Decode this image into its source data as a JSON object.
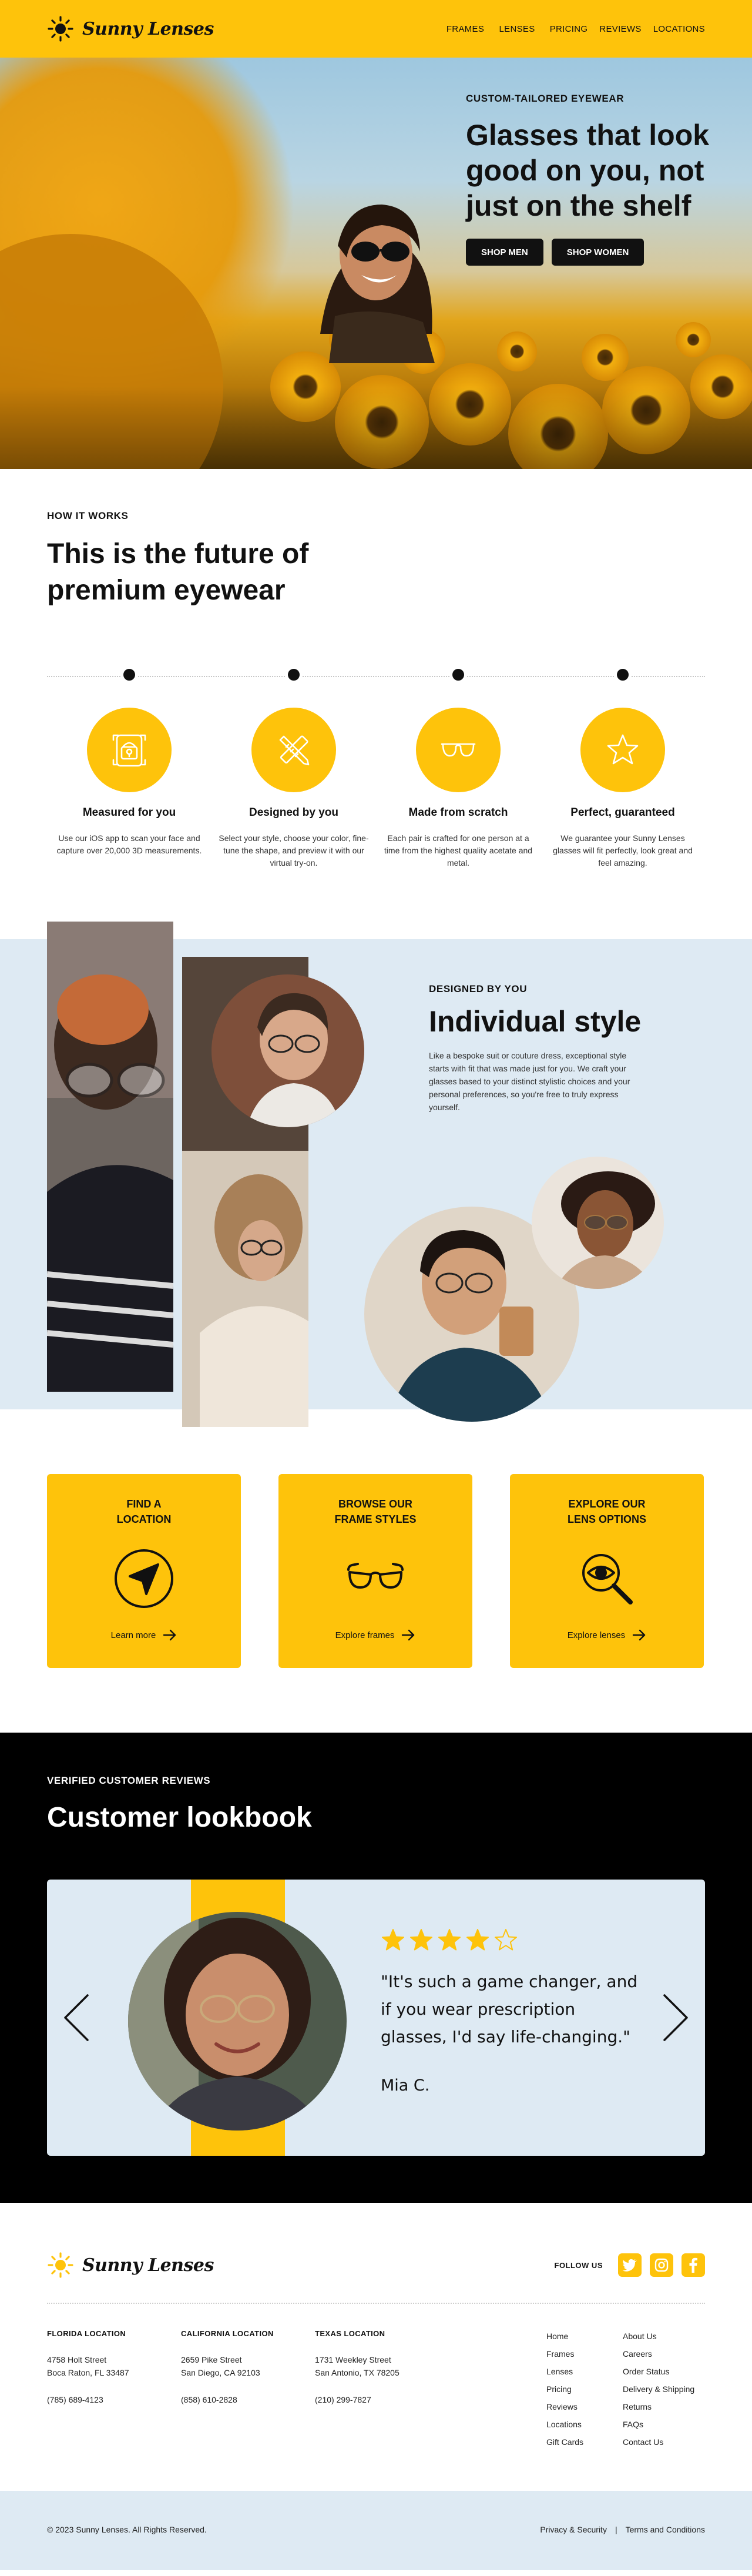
{
  "header": {
    "logo_text": "Sunny Lenses",
    "nav": [
      "FRAMES",
      "LENSES",
      "PRICING",
      "REVIEWS",
      "LOCATIONS"
    ]
  },
  "hero": {
    "eyebrow": "CUSTOM-TAILORED EYEWEAR",
    "title": "Glasses that look good on you, not just on the shelf",
    "buttons": [
      "SHOP MEN",
      "SHOP WOMEN"
    ]
  },
  "how_it_works": {
    "eyebrow": "HOW IT WORKS",
    "title": "This is the future of premium eyewear",
    "steps": [
      {
        "title": "Measured for you",
        "icon": "phone-scan-icon",
        "desc": "Use our iOS app to scan your face and capture over 20,000 3D measurements."
      },
      {
        "title": "Designed by you",
        "icon": "pencil-ruler-icon",
        "desc": "Select your style, choose your color, fine-tune the shape, and preview it with our virtual try-on."
      },
      {
        "title": "Made from scratch",
        "icon": "glasses-icon",
        "desc": "Each pair is crafted for one person at a time from the highest quality acetate and metal."
      },
      {
        "title": "Perfect, guaranteed",
        "icon": "star-icon",
        "desc": "We guarantee your Sunny Lenses glasses will fit perfectly, look great and feel amazing."
      }
    ]
  },
  "individual_style": {
    "eyebrow": "DESIGNED BY YOU",
    "title": "Individual style",
    "desc": "Like a bespoke suit or couture dress, exceptional style starts with fit that was made just for you. We craft your glasses based to your distinct stylistic choices and your personal preferences, so you're free to truly express yourself."
  },
  "cards": [
    {
      "title": "FIND A\nLOCATION",
      "icon": "navigation-arrow-icon",
      "link": "Learn more"
    },
    {
      "title": "BROWSE OUR\nFRAME STYLES",
      "icon": "glasses-icon",
      "link": "Explore frames"
    },
    {
      "title": "EXPLORE OUR\nLENS OPTIONS",
      "icon": "magnifier-eye-icon",
      "link": "Explore lenses"
    }
  ],
  "reviews": {
    "eyebrow": "VERIFIED CUSTOMER REVIEWS",
    "title": "Customer lookbook",
    "rating": 4,
    "max_rating": 5,
    "quote": "\"It's such a game changer, and if you wear prescription glasses, I'd say life-changing.\"",
    "reviewer": "Mia C."
  },
  "footer": {
    "logo_text": "Sunny Lenses",
    "follow_label": "FOLLOW US",
    "social": [
      "twitter-icon",
      "instagram-icon",
      "facebook-icon"
    ],
    "locations": [
      {
        "title": "FLORIDA LOCATION",
        "line1": "4758 Holt Street",
        "line2": "Boca Raton, FL 33487",
        "phone": "(785) 689-4123"
      },
      {
        "title": "CALIFORNIA LOCATION",
        "line1": "2659 Pike Street",
        "line2": "San Diego, CA 92103",
        "phone": "(858) 610-2828"
      },
      {
        "title": "TEXAS LOCATION",
        "line1": "1731 Weekley Street",
        "line2": "San Antonio, TX 78205",
        "phone": "(210) 299-7827"
      }
    ],
    "links_col1": [
      "Home",
      "Frames",
      "Lenses",
      "Pricing",
      "Reviews",
      "Locations",
      "Gift Cards"
    ],
    "links_col2": [
      "About Us",
      "Careers",
      "Order Status",
      "Delivery & Shipping",
      "Returns",
      "FAQs",
      "Contact Us"
    ],
    "copyright": "© 2023 Sunny Lenses. All Rights Reserved.",
    "legal": [
      "Privacy & Security",
      "Terms and Conditions"
    ],
    "legal_separator": "|"
  },
  "colors": {
    "brand_yellow": "#fec30b",
    "light_blue": "#deeaf3",
    "dark": "#111111"
  }
}
